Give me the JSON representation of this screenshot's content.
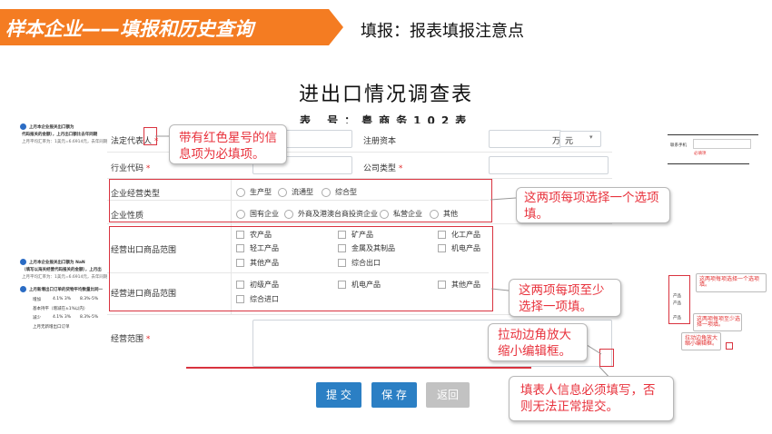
{
  "header": {
    "banner": "样本企业——填报和历史查询",
    "subtitle": "填报：报表填报注意点",
    "banner_color": "#f47c22"
  },
  "form": {
    "title": "进出口情况调查表",
    "number": "表 号：粤商务102表",
    "fields": {
      "legal_rep": "法定代表人",
      "registered_capital": "注册资本",
      "capital_unit": "万",
      "currency": "元",
      "industry_code": "行业代码",
      "company_type": "公司类型",
      "required_mark": "*"
    },
    "business_type": {
      "label": "企业经营类型",
      "options": [
        "生产型",
        "流通型",
        "综合型"
      ]
    },
    "enterprise_nature": {
      "label": "企业性质",
      "options": [
        "国有企业",
        "外商及港澳台商投资企业",
        "私营企业",
        "其他"
      ]
    },
    "export_range": {
      "label": "经营出口商品范围",
      "options": [
        "农产品",
        "矿产品",
        "化工产品",
        "轻工产品",
        "金属及其制品",
        "机电产品",
        "其他产品",
        "综合出口"
      ]
    },
    "import_range": {
      "label": "经营进口商品范围",
      "options": [
        "初级产品",
        "机电产品",
        "其他产品",
        "综合进口"
      ]
    },
    "business_scope": {
      "label": "经营范围"
    }
  },
  "buttons": {
    "submit": "提 交",
    "save": "保 存",
    "back": "返回"
  },
  "callouts": {
    "required": "带有红色星号的信息项为必填项。",
    "single_choice": "这两项每项选择一个选项填。",
    "multi_choice": "这两项每项至少选择一项填。",
    "resize": "拉动边角放大缩小编辑框。",
    "filler_info": "填表人信息必须填写，否则无法正常提交。"
  },
  "left_doc": {
    "line1": "上月本企业报关出口额为",
    "line2": "代码报关的金额），上月出口额比去年同期",
    "line3": "上月平均汇率为：1美元=6.6914元，去年同期",
    "line4": "上月本企业报关出口额为 NaN",
    "line5": "（填写以海关经营代码报关的金额），上月出",
    "line6": "上月平均汇率为：1美元=6.6914元，去年同期",
    "line7": "上月新增出口订单的货物平均数量比同一",
    "opt1": "增加",
    "opt1a": "4.1% 3%",
    "opt1b": "8.3%-5%",
    "opt2": "基本持平（增减在±1%以内）",
    "opt3": "减少",
    "opt3a": "4.1% 3%",
    "opt3b": "8.3%-5%",
    "opt4": "上月无新增出口订单"
  },
  "right_doc": {
    "phone": "联系手机",
    "required_note": "必填项",
    "note1": "这两项每项选择一个选项填。",
    "note2": "这两项每项至少选择一项填。",
    "note3": "拉动边角放大缩小编辑框。",
    "frag1": "产品",
    "frag2": "产品",
    "frag3": "产品"
  },
  "colors": {
    "accent_red": "#d9333f",
    "button_blue": "#2b7fc4",
    "button_gray": "#c2c2c2"
  }
}
